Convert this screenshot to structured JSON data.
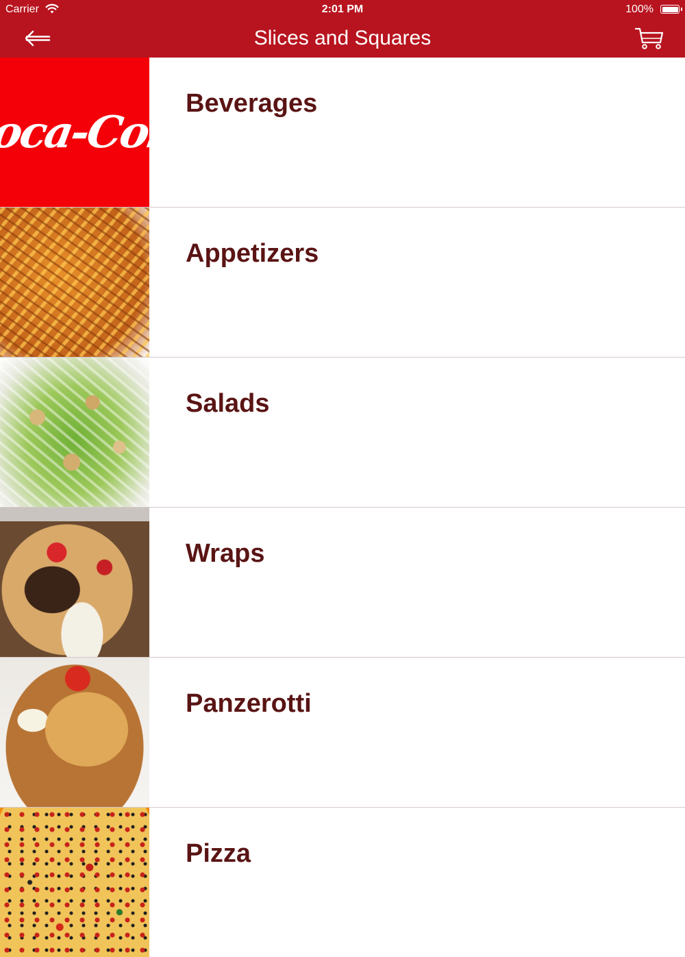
{
  "status_bar": {
    "carrier": "Carrier",
    "time": "2:01 PM",
    "battery": "100%"
  },
  "nav": {
    "title": "Slices and Squares",
    "back_icon": "back-arrow-icon",
    "cart_icon": "cart-icon"
  },
  "categories": [
    {
      "label": "Beverages",
      "thumb": "coca-cola-logo",
      "logo_text": "Coca-Cola"
    },
    {
      "label": "Appetizers",
      "thumb": "fries-photo"
    },
    {
      "label": "Salads",
      "thumb": "salad-photo"
    },
    {
      "label": "Wraps",
      "thumb": "wrap-photo"
    },
    {
      "label": "Panzerotti",
      "thumb": "panzerotti-photo"
    },
    {
      "label": "Pizza",
      "thumb": "pizza-photo"
    }
  ],
  "colors": {
    "header_bg": "#b8141f",
    "label_text": "#5a1414",
    "divider": "#d5c8c9"
  }
}
